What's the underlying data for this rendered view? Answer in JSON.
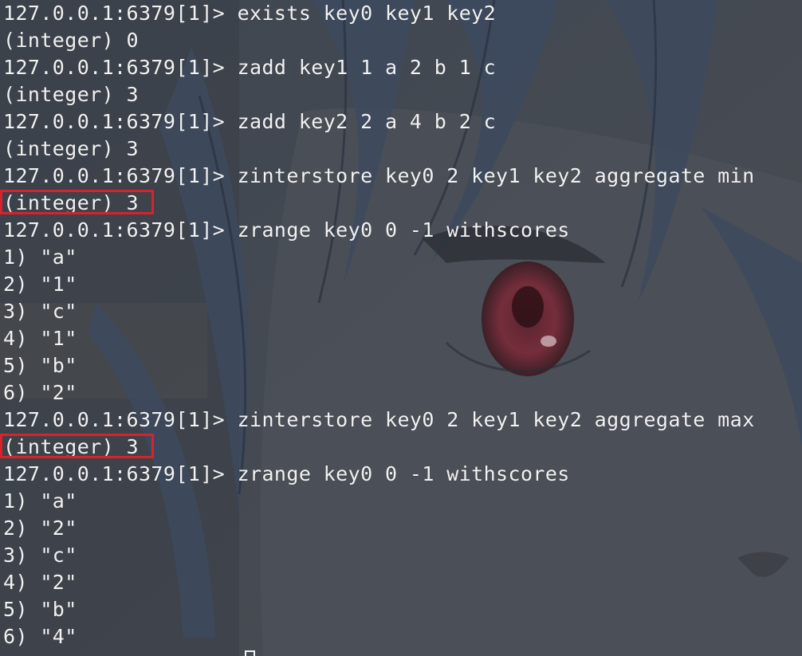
{
  "terminal": {
    "lines": [
      "127.0.0.1:6379[1]> exists key0 key1 key2",
      "(integer) 0",
      "127.0.0.1:6379[1]> zadd key1 1 a 2 b 1 c",
      "(integer) 3",
      "127.0.0.1:6379[1]> zadd key2 2 a 4 b 2 c",
      "(integer) 3",
      "127.0.0.1:6379[1]> zinterstore key0 2 key1 key2 aggregate min",
      "(integer) 3",
      "127.0.0.1:6379[1]> zrange key0 0 -1 withscores",
      "1) \"a\"",
      "2) \"1\"",
      "3) \"c\"",
      "4) \"1\"",
      "5) \"b\"",
      "6) \"2\"",
      "127.0.0.1:6379[1]> zinterstore key0 2 key1 key2 aggregate max",
      "(integer) 3",
      "127.0.0.1:6379[1]> zrange key0 0 -1 withscores",
      "1) \"a\"",
      "2) \"2\"",
      "3) \"c\"",
      "4) \"2\"",
      "5) \"b\"",
      "6) \"4\""
    ]
  },
  "colors": {
    "text": "#f2f2f2",
    "highlight_border": "#d9222a",
    "background": "#404751"
  }
}
